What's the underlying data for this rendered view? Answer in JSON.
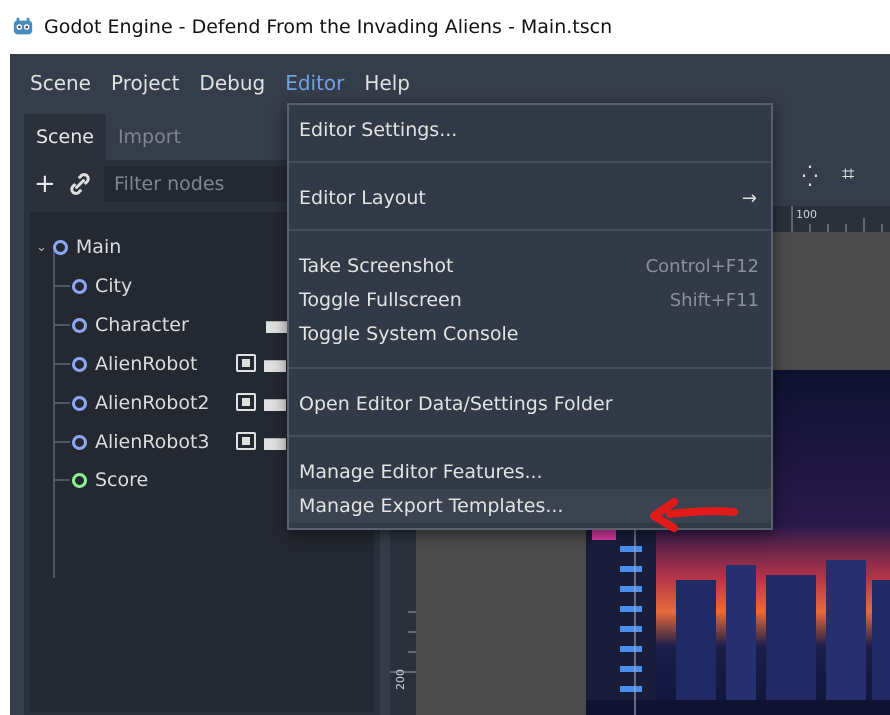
{
  "window": {
    "title": "Godot Engine - Defend From the Invading Aliens - Main.tscn"
  },
  "menubar": [
    "Scene",
    "Project",
    "Debug",
    "Editor",
    "Help"
  ],
  "dock": {
    "tabs": [
      "Scene",
      "Import"
    ],
    "filter_placeholder": "Filter nodes",
    "nodes": [
      "Main",
      "City",
      "Character",
      "AlienRobot",
      "AlienRobot2",
      "AlienRobot3",
      "Score"
    ]
  },
  "ruler": {
    "h_label": "100",
    "v_label": "200"
  },
  "editor_menu": {
    "editor_settings": "Editor Settings...",
    "editor_layout": "Editor Layout",
    "layout_arrow": "→",
    "take_screenshot": "Take Screenshot",
    "take_screenshot_shortcut": "Control+F12",
    "toggle_fullscreen": "Toggle Fullscreen",
    "toggle_fullscreen_shortcut": "Shift+F11",
    "toggle_console": "Toggle System Console",
    "open_data_folder": "Open Editor Data/Settings Folder",
    "manage_features": "Manage Editor Features...",
    "manage_templates": "Manage Export Templates..."
  },
  "colors": {
    "accent": "#6ea2e6",
    "node_blue": "#8da5f3",
    "node_green": "#8eef97",
    "annotation_red": "#e21a1a"
  }
}
